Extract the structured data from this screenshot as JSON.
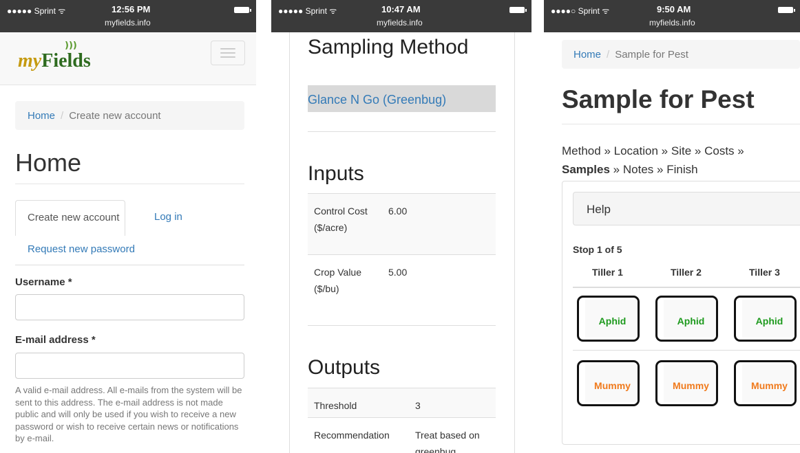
{
  "screens": [
    {
      "status": {
        "carrier": "●●●●● Sprint ᯤ",
        "time": "12:56 PM",
        "url": "myfields.info"
      },
      "logo": {
        "my": "my",
        "fields": "Fields"
      },
      "breadcrumb": {
        "home": "Home",
        "current": "Create new account"
      },
      "title": "Home",
      "tabs": {
        "create": "Create new account",
        "login": "Log in",
        "request": "Request new password"
      },
      "username": {
        "label": "Username *",
        "value": ""
      },
      "email": {
        "label": "E-mail address *",
        "value": ""
      },
      "help": "A valid e-mail address. All e-mails from the system will be sent to this address. The e-mail address is not made public and will only be used if you wish to receive a new password or wish to receive certain news or notifications by e-mail."
    },
    {
      "status": {
        "carrier": "●●●●● Sprint ᯤ",
        "time": "10:47 AM",
        "url": "myfields.info"
      },
      "heading": "Sampling Method",
      "method": "Glance N Go (Greenbug)",
      "inputs": {
        "heading": "Inputs",
        "rows": [
          {
            "key": "Control Cost ($/acre)",
            "value": "6.00"
          },
          {
            "key": "Crop Value ($/bu)",
            "value": "5.00"
          }
        ]
      },
      "outputs": {
        "heading": "Outputs",
        "rows": [
          {
            "key": "Threshold",
            "value": "3"
          },
          {
            "key": "Recommendation",
            "value": "Treat based on greenbug"
          }
        ]
      }
    },
    {
      "status": {
        "carrier": "●●●●○ Sprint ᯤ",
        "time": "9:50 AM",
        "url": "myfields.info"
      },
      "breadcrumb": {
        "home": "Home",
        "current": "Sample for Pest"
      },
      "title": "Sample for Pest",
      "steps": {
        "method": "Method",
        "location": "Location",
        "site": "Site",
        "costs": "Costs",
        "samples": "Samples",
        "notes": "Notes",
        "finish": "Finish",
        "sep": "»"
      },
      "help": "Help",
      "stop": "Stop 1 of 5",
      "tillers": [
        "Tiller 1",
        "Tiller 2",
        "Tiller 3"
      ],
      "row1": [
        "Aphid",
        "Aphid",
        "Aphid"
      ],
      "row2": [
        "Mummy",
        "Mummy",
        "Mummy"
      ]
    }
  ],
  "colors": {
    "link": "#337ab7",
    "aphid": "#1e9a1e",
    "mummy": "#f07a1c",
    "statusbar": "#3a3a3a"
  }
}
